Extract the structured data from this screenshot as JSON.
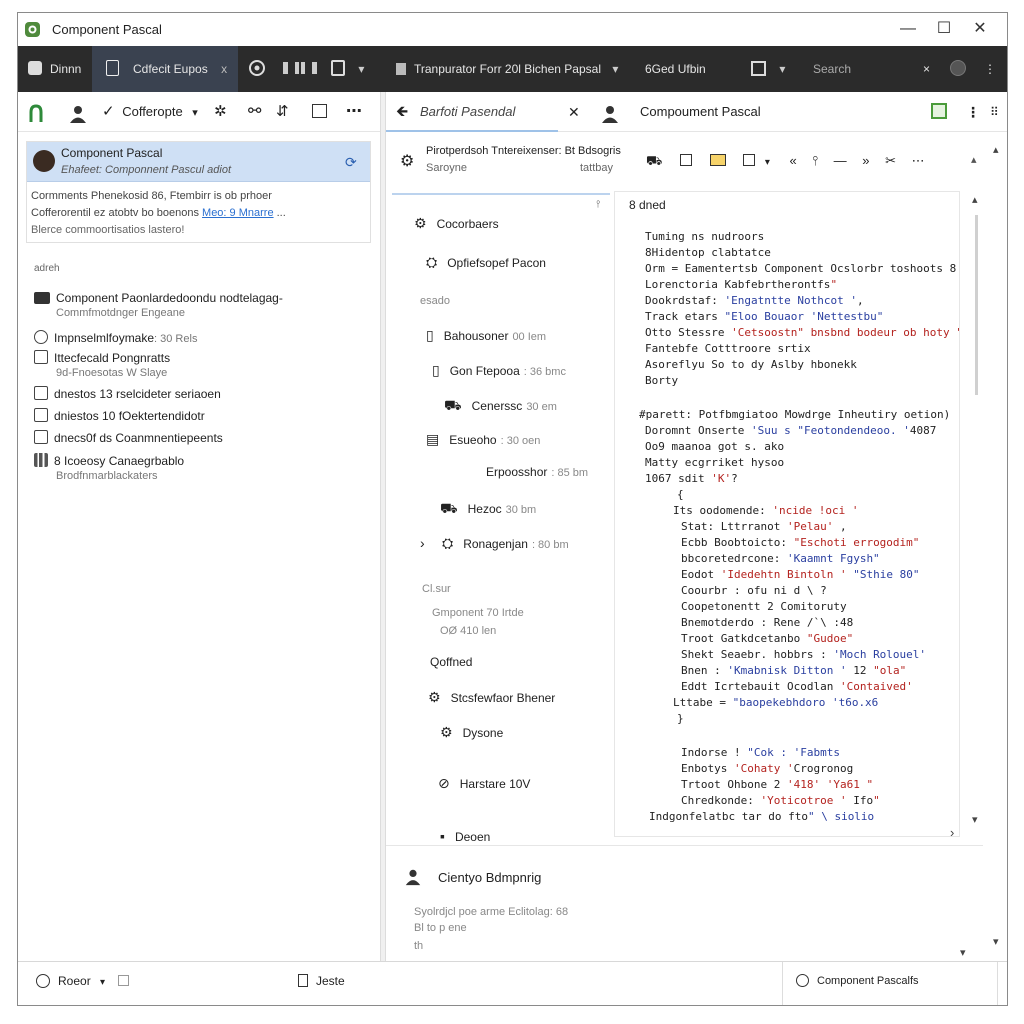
{
  "window": {
    "title": "Component Pascal",
    "minimize": "—",
    "maximize": "☐",
    "close": "✕"
  },
  "darkbar": {
    "tab1": "Dinnn",
    "tab2": "Cdfecit Eupos",
    "tab2_close": "x",
    "project": "Tranpurator Forr 20l Bichen Papsal",
    "project_caret": "▾",
    "branch": "6Ged Ufbin",
    "search_placeholder": "Search",
    "search_clear": "×",
    "more": "⋮"
  },
  "leftbar": {
    "commit_label": "Cofferopte",
    "more": "⋯"
  },
  "rightbar": {
    "tab_left": "Barfoti Pasendal",
    "tab_close": "✕",
    "tab_right": "Compoument Pascal",
    "more": "⋮"
  },
  "leftpanel": {
    "card_title": "Component Pascal",
    "card_subtitle": "Ehafeet: Componnent Pascul adiot",
    "card_line1": "Cormments Phenekosid 86, Ftembirr is ob prhoer",
    "card_line2_pre": "Cofferorentil ez atobtv bo boenons",
    "card_line2_link": "Meo: 9 Mnarre",
    "card_line2_post": "...",
    "card_line3": "Blerce commoortisatios lastero!",
    "section": "adreh",
    "items": [
      {
        "label": "Component Paonlardedoondu nodtelagag-",
        "sub": "Commfmotdnger Engeane"
      },
      {
        "label": "Impnselmlfoymake",
        "meta": ": 30 Rels"
      },
      {
        "label": "Ittecfecald Pongnratts",
        "sub": "9d-Fnoesotas W Slaye"
      },
      {
        "label": "dnestos 13 rselcideter seriaoen"
      },
      {
        "label": "dniestos 10 fOektertendidotr"
      },
      {
        "label": "dnecs0f ds Coanmnentiepeents"
      },
      {
        "label": "8 Icoeosy Canaegrbablo",
        "sub": "Brodfnmarblackaters"
      }
    ]
  },
  "header2": {
    "line1": "Pirotperdsoh Tntereixenser: Bt Bdsogris",
    "line2": "Saroyne",
    "line2_right": "tattbay"
  },
  "tree": {
    "items": [
      {
        "label": "Cocorbaers"
      },
      {
        "label": "Opfiefsopef Pacon"
      },
      {
        "label": "esado",
        "dim": true
      },
      {
        "label": "Bahousoner",
        "meta": "00 Iem"
      },
      {
        "label": "Gon Ftepooa",
        "meta": ": 36 bmc"
      },
      {
        "label": "Cenerssc",
        "meta": "30 em"
      },
      {
        "label": "Esueoho",
        "meta": ": 30 oen"
      },
      {
        "label": "Erpoosshor",
        "meta": ": 85 bm"
      },
      {
        "label": "Hezoc",
        "meta": "30 bm"
      },
      {
        "label": "Ronagenjan",
        "meta": ": 80 bm"
      },
      {
        "label": "Cl.sur",
        "dim": true
      },
      {
        "label": "Gmponent 70 Irtde",
        "dim": true
      },
      {
        "label": "OØ 410 len",
        "dim": true
      },
      {
        "label": "Qoffned"
      },
      {
        "label": "Stcsfewfaor Bhener"
      },
      {
        "label": "Dysone"
      },
      {
        "label": "Harstare 10V"
      },
      {
        "label": "Deoen"
      }
    ]
  },
  "code": {
    "header": "8 dned",
    "lines": [
      {
        "t": "Tuming ns nudroors",
        "c": "cm"
      },
      {
        "t": "8Hidentop clabtatce",
        "c": "cm"
      },
      {
        "t": "Orm = Eamentertsb Component Ocslorbr toshoots 8",
        "c": ""
      },
      {
        "t": "Lorenctoria Kabfebrtherontfs\"",
        "c": ""
      },
      {
        "t": "Dookrdstaf: 'Engatntte Nothcot ', ",
        "c": ""
      },
      {
        "t": "Track etars \"Eloo Bouaor 'Nettestbu\"",
        "c": ""
      },
      {
        "t": "Otto Stessre 'Cetsoostn\" bnsbnd bodeur ob hoty \"",
        "c": ""
      },
      {
        "t": "Fantebfe Cotttroore srtix",
        "c": ""
      },
      {
        "t": "Asoreflyu So to dy Aslby hbonekk",
        "c": ""
      },
      {
        "t": "Borty",
        "c": "cm"
      },
      {
        "t": "#parett: Potfbmgiatoo Mowdrge Inheutiry oetion)",
        "c": ""
      },
      {
        "t": "Doromnt Onserte 'Suu s \"Feotondendeoo. '4087",
        "c": ""
      },
      {
        "t": "Oo9 maanoa got s. ako",
        "c": ""
      },
      {
        "t": "Matty ecgrriket hysoo",
        "c": ""
      },
      {
        "t": "1067 sdit 'K'?",
        "c": ""
      },
      {
        "t": "{",
        "c": ""
      },
      {
        "t": "Its oodomende: 'ncide !oci '",
        "c": ""
      },
      {
        "t": "Stat: Lttrranot 'Pelau' ,",
        "c": ""
      },
      {
        "t": "Ecbb Boobtoicto: \"Eschoti errogodim\"",
        "c": ""
      },
      {
        "t": "bbcoretedrcone: 'Kaamnt Fgysh\"",
        "c": ""
      },
      {
        "t": "Eodot 'Idedehtn Bintoln ' \"Sthie 80\"",
        "c": ""
      },
      {
        "t": "Coourbr : ofu ni d \\ ?",
        "c": ""
      },
      {
        "t": "Coopetonentt 2 Comitoruty",
        "c": ""
      },
      {
        "t": "Bnemotderdo : Rene /`\\ :48",
        "c": ""
      },
      {
        "t": "Troot Gatkdcetanbo \"Gudoe\"",
        "c": ""
      },
      {
        "t": "Shekt Seaebr. hobbrs : 'Moch Rolouel'",
        "c": ""
      },
      {
        "t": "Bnen : 'Kmabnisk Ditton ' 12 \"ola\"",
        "c": ""
      },
      {
        "t": "Eddt Icrtebauit Ocodlan 'Contaived'",
        "c": ""
      },
      {
        "t": "Lttabe = \"baopekebhdoro 't6o.x6",
        "c": ""
      },
      {
        "t": "}",
        "c": ""
      },
      {
        "t": "Indorse ! \"Cok : 'Fabmts",
        "c": ""
      },
      {
        "t": "Enbotys 'Cohaty 'Crogronog",
        "c": ""
      },
      {
        "t": "Trtoot Ohbone 2 '418' 'Ya61 \"",
        "c": ""
      },
      {
        "t": "Chredkonde: 'Yoticotroe ' Ifo\"",
        "c": ""
      },
      {
        "t": "Indgonfelatbc tar do fto\" \\ siolio",
        "c": "cm"
      }
    ]
  },
  "bottom": {
    "title": "Cientyo Bdmpnrig",
    "line1": "Syolrdjcl poe arme Eclitolag: 68",
    "line2": "Bl to p ene",
    "line3": "th"
  },
  "status": {
    "left": "Roeor",
    "middle": "Jeste",
    "right": "Component Pascalfs"
  },
  "colors": {
    "accent": "#cfe0f5",
    "dark": "#2b2b2b",
    "string": "#b4231f",
    "keyword": "#2a3fa0"
  }
}
